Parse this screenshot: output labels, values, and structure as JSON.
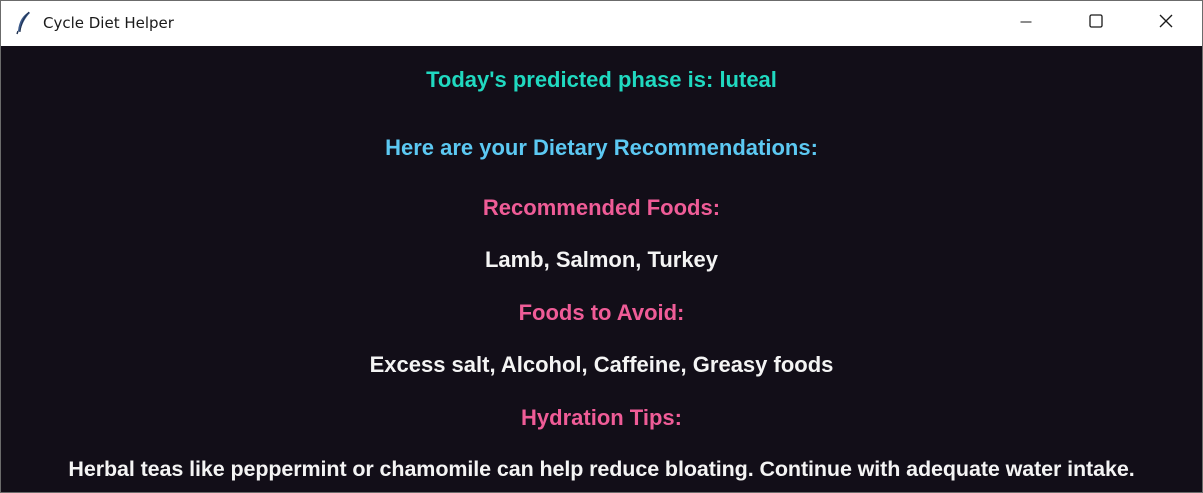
{
  "window": {
    "title": "Cycle Diet Helper",
    "icon": "feather-icon"
  },
  "controls": {
    "minimize_icon": "minimize-icon",
    "maximize_icon": "maximize-icon",
    "close_icon": "close-icon"
  },
  "main": {
    "phase_text": "Today's predicted phase is: luteal",
    "intro_text": "Here are your Dietary Recommendations:",
    "sections": [
      {
        "heading": "Recommended Foods:",
        "body": "Lamb, Salmon, Turkey"
      },
      {
        "heading": "Foods to Avoid:",
        "body": "Excess salt, Alcohol, Caffeine, Greasy foods"
      },
      {
        "heading": "Hydration Tips:",
        "body": "Herbal teas like peppermint or chamomile can help reduce bloating. Continue with adequate water intake."
      }
    ]
  },
  "colors": {
    "background": "#120e18",
    "phase": "#20d9c0",
    "intro": "#5cc8f2",
    "heading": "#ef5c97",
    "body": "#f4f4f4"
  }
}
